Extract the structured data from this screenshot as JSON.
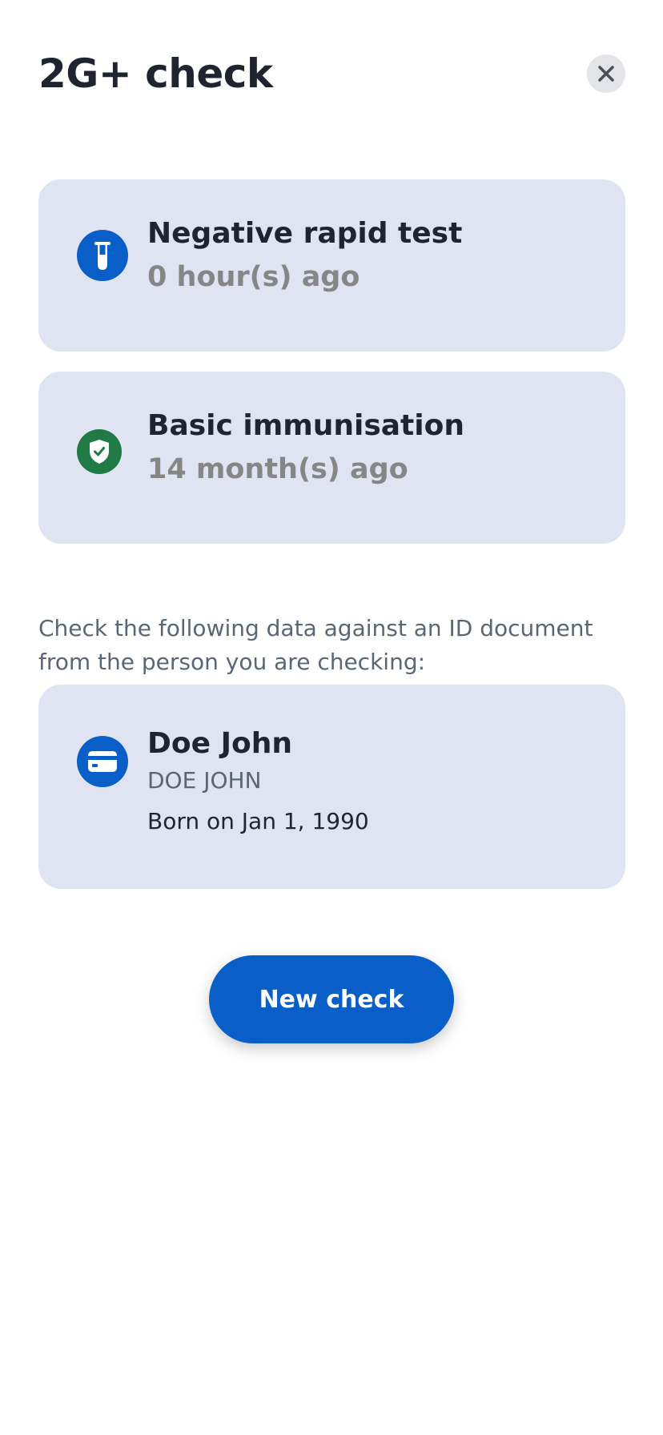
{
  "header": {
    "title": "2G+ check",
    "close_icon": "close-icon"
  },
  "rapid_test": {
    "icon": "test-tube-icon",
    "title": "Negative rapid test",
    "subtitle": "0 hour(s) ago"
  },
  "immunisation": {
    "icon": "shield-check-icon",
    "title": "Basic immunisation",
    "subtitle": "14 month(s) ago"
  },
  "instructions": "Check the following data against an ID document from the person you are checking:",
  "person": {
    "icon": "id-card-icon",
    "name": "Doe John",
    "name_upper": "DOE JOHN",
    "dob": "Born on Jan 1, 1990"
  },
  "actions": {
    "new_check_label": "New check"
  },
  "colors": {
    "accent": "#0a5ec7",
    "success": "#1f7a45",
    "card_bg": "#e0e3f2"
  }
}
